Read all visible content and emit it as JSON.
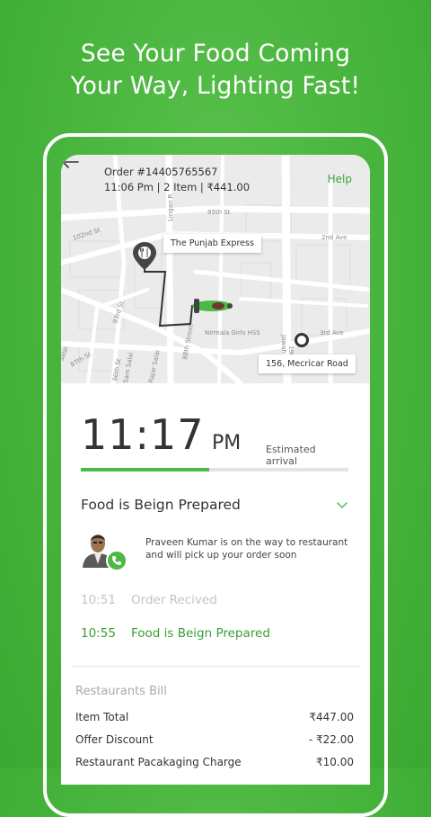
{
  "headline": {
    "line1": "See Your Food Coming",
    "line2": "Your Way, Lighting Fast!"
  },
  "order": {
    "id_label": "Order #14405765567",
    "meta": "11:06 Pm | 2 Item | ₹441.00",
    "help_label": "Help"
  },
  "map": {
    "restaurant_label": "The Punjab Express",
    "destination_label": "156, Mecricar Road",
    "streets": [
      "95th St",
      "102nd St",
      "2nd Ave",
      "Lingan R",
      "93rd St",
      "88th Street",
      "Nirmala Girls HSS",
      "19th A",
      "Jawah",
      "3rd Ave",
      "Sam Salai",
      "Rajar Salai",
      "87th St",
      "96th St",
      "Salai"
    ]
  },
  "eta": {
    "time": "11:17",
    "ampm": "PM",
    "label": "Estimated arrival",
    "progress": 0.48
  },
  "status": {
    "title": "Food is Beign Prepared",
    "driver_message": "Praveen Kumar is on the way to restaurant and will pick up your order soon"
  },
  "timeline": [
    {
      "time": "10:51",
      "label": "Order Recived"
    },
    {
      "time": "10:55",
      "label": "Food is Beign Prepared"
    }
  ],
  "bill": {
    "title": "Restaurants Bill",
    "items": [
      {
        "label": "Item Total",
        "amount": "₹447.00"
      },
      {
        "label": "Offer Discount",
        "amount": "- ₹22.00"
      },
      {
        "label": "Restaurant Pacakaging Charge",
        "amount": "₹10.00"
      }
    ]
  },
  "colors": {
    "brand_green": "#4cb944",
    "background_green": "#47b43c",
    "route": "#333333"
  }
}
